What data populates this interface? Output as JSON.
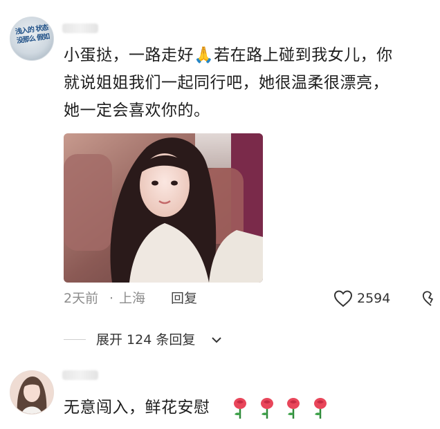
{
  "comment1": {
    "avatar_text": "浅入的 状态 没那么 假如",
    "text_line1": "小蛋挞，一路走好",
    "emoji": "🙏",
    "text_line1b": "若在路上碰到我女儿，你",
    "text_line2": "就说姐姐我们一起同行吧，她很温柔很漂亮，",
    "text_line3": "她一定会喜欢你的。",
    "time": "2天前",
    "separator": "·",
    "location": "上海",
    "reply_label": "回复",
    "likes": "2594"
  },
  "expand": {
    "label": "展开 124 条回复"
  },
  "comment2": {
    "text": "无意闯入，鲜花安慰"
  },
  "colors": {
    "text_primary": "#1d1d1d",
    "text_secondary": "#8c8c8c",
    "background": "#ffffff"
  },
  "icons": [
    "heart-icon",
    "broken-heart-icon",
    "chevron-down-icon",
    "rose-icon"
  ]
}
